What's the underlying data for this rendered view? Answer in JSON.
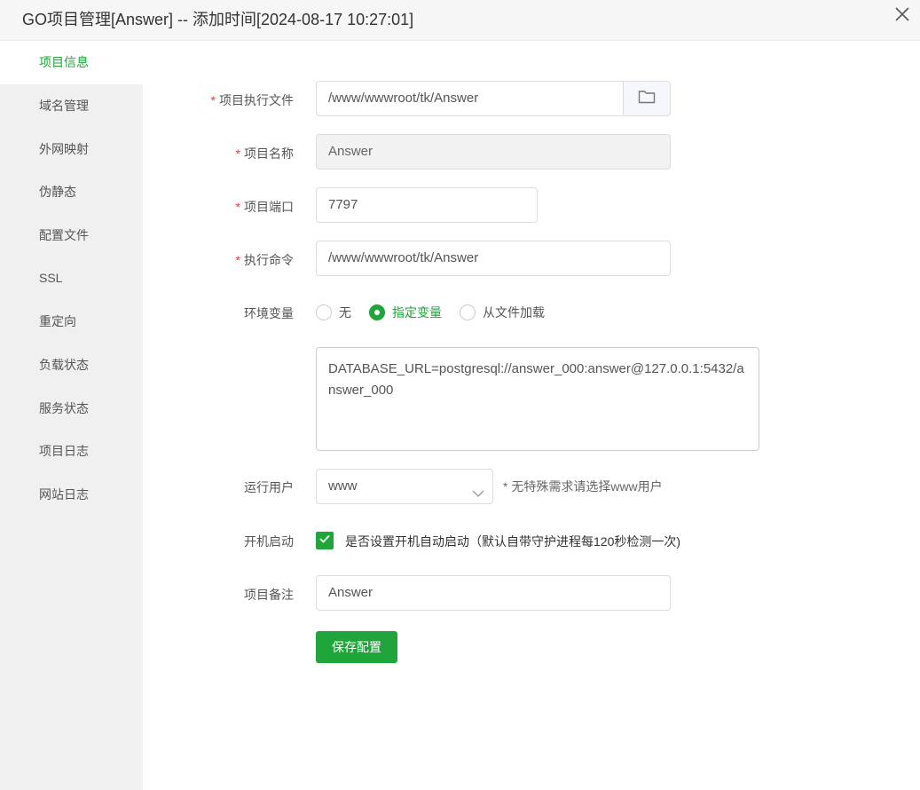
{
  "dialog": {
    "title": "GO项目管理[Answer] -- 添加时间[2024-08-17 10:27:01]"
  },
  "sidebar": {
    "items": [
      {
        "label": "项目信息",
        "active": true
      },
      {
        "label": "域名管理"
      },
      {
        "label": "外网映射"
      },
      {
        "label": "伪静态"
      },
      {
        "label": "配置文件"
      },
      {
        "label": "SSL"
      },
      {
        "label": "重定向"
      },
      {
        "label": "负载状态"
      },
      {
        "label": "服务状态"
      },
      {
        "label": "项目日志"
      },
      {
        "label": "网站日志"
      }
    ]
  },
  "form": {
    "required_mark": "*",
    "exec_file": {
      "label": "项目执行文件",
      "value": "/www/wwwroot/tk/Answer"
    },
    "project_name": {
      "label": "项目名称",
      "value": "Answer"
    },
    "port": {
      "label": "项目端口",
      "value": "7797"
    },
    "command": {
      "label": "执行命令",
      "value": "/www/wwwroot/tk/Answer"
    },
    "env": {
      "label": "环境变量",
      "options": [
        "无",
        "指定变量",
        "从文件加载"
      ],
      "selected": "指定变量",
      "value": "DATABASE_URL=postgresql://answer_000:answer@127.0.0.1:5432/answer_000"
    },
    "run_user": {
      "label": "运行用户",
      "value": "www",
      "hint": "* 无特殊需求请选择www用户"
    },
    "autostart": {
      "label": "开机启动",
      "checked": true,
      "text": "是否设置开机自动启动（默认自带守护进程每120秒检测一次)"
    },
    "remark": {
      "label": "项目备注",
      "value": "Answer"
    },
    "save_label": "保存配置"
  },
  "colors": {
    "accent": "#20a53a",
    "required": "#e4393c"
  }
}
